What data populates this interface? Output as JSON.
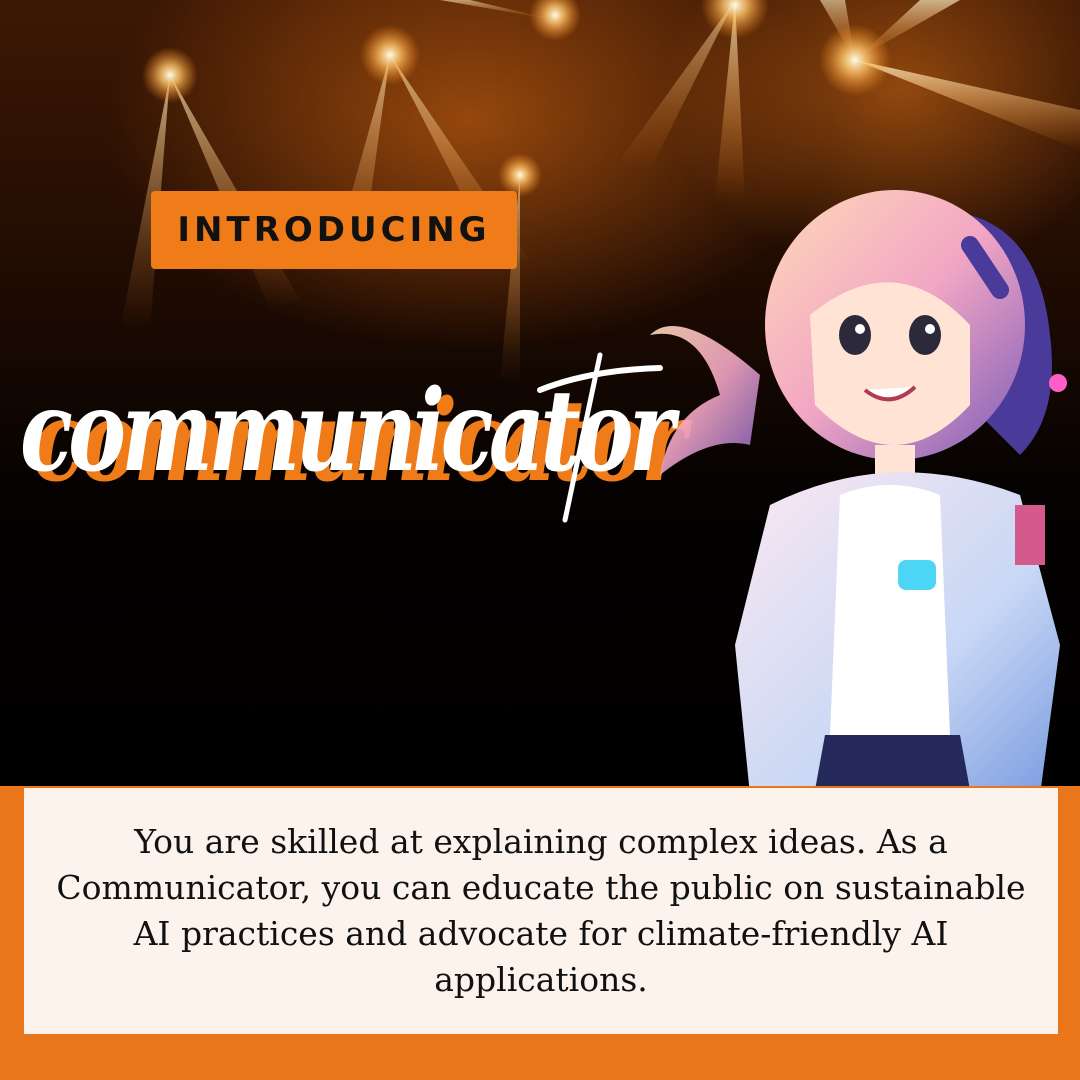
{
  "badge": {
    "label": "INTRODUCING"
  },
  "title": {
    "text": "communicator"
  },
  "description": {
    "text": "You are skilled at explaining complex ideas. As a Communicator, you can educate the public on sustainable AI practices and advocate for climate-friendly AI applications."
  },
  "colors": {
    "accent": "#ef7c19",
    "panel_background": "#fcf3ec",
    "text_dark": "#111111",
    "title_white": "#ffffff"
  }
}
